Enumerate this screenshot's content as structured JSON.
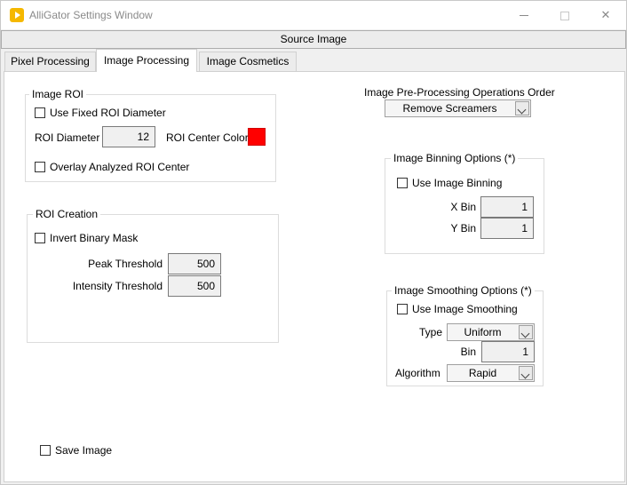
{
  "window": {
    "title": "AlliGator Settings Window",
    "minimize": "—",
    "maximize": "",
    "close": "✕"
  },
  "source_button": "Source Image",
  "tabs": [
    {
      "label": "Pixel Processing"
    },
    {
      "label": "Image Processing"
    },
    {
      "label": "Image Cosmetics"
    }
  ],
  "image_roi": {
    "title": "Image ROI",
    "use_fixed_diameter": "Use Fixed ROI Diameter",
    "roi_diameter_label": "ROI Diameter",
    "roi_diameter_value": "12",
    "roi_center_color_label": "ROI Center Color",
    "roi_center_color": "#ff0000",
    "overlay_center": "Overlay Analyzed ROI Center"
  },
  "roi_creation": {
    "title": "ROI Creation",
    "invert_mask": "Invert Binary Mask",
    "peak_threshold_label": "Peak Threshold",
    "peak_threshold_value": "500",
    "intensity_threshold_label": "Intensity Threshold",
    "intensity_threshold_value": "500"
  },
  "preprocessing": {
    "title": "Image Pre-Processing Operations Order",
    "selected": "Remove Screamers"
  },
  "binning": {
    "title": "Image Binning Options (*)",
    "use_binning": "Use Image Binning",
    "x_bin_label": "X Bin",
    "x_bin_value": "1",
    "y_bin_label": "Y Bin",
    "y_bin_value": "1"
  },
  "smoothing": {
    "title": "Image Smoothing Options (*)",
    "use_smoothing": "Use Image Smoothing",
    "type_label": "Type",
    "type_value": "Uniform",
    "bin_label": "Bin",
    "bin_value": "1",
    "algorithm_label": "Algorithm",
    "algorithm_value": "Rapid"
  },
  "save_image": "Save Image"
}
